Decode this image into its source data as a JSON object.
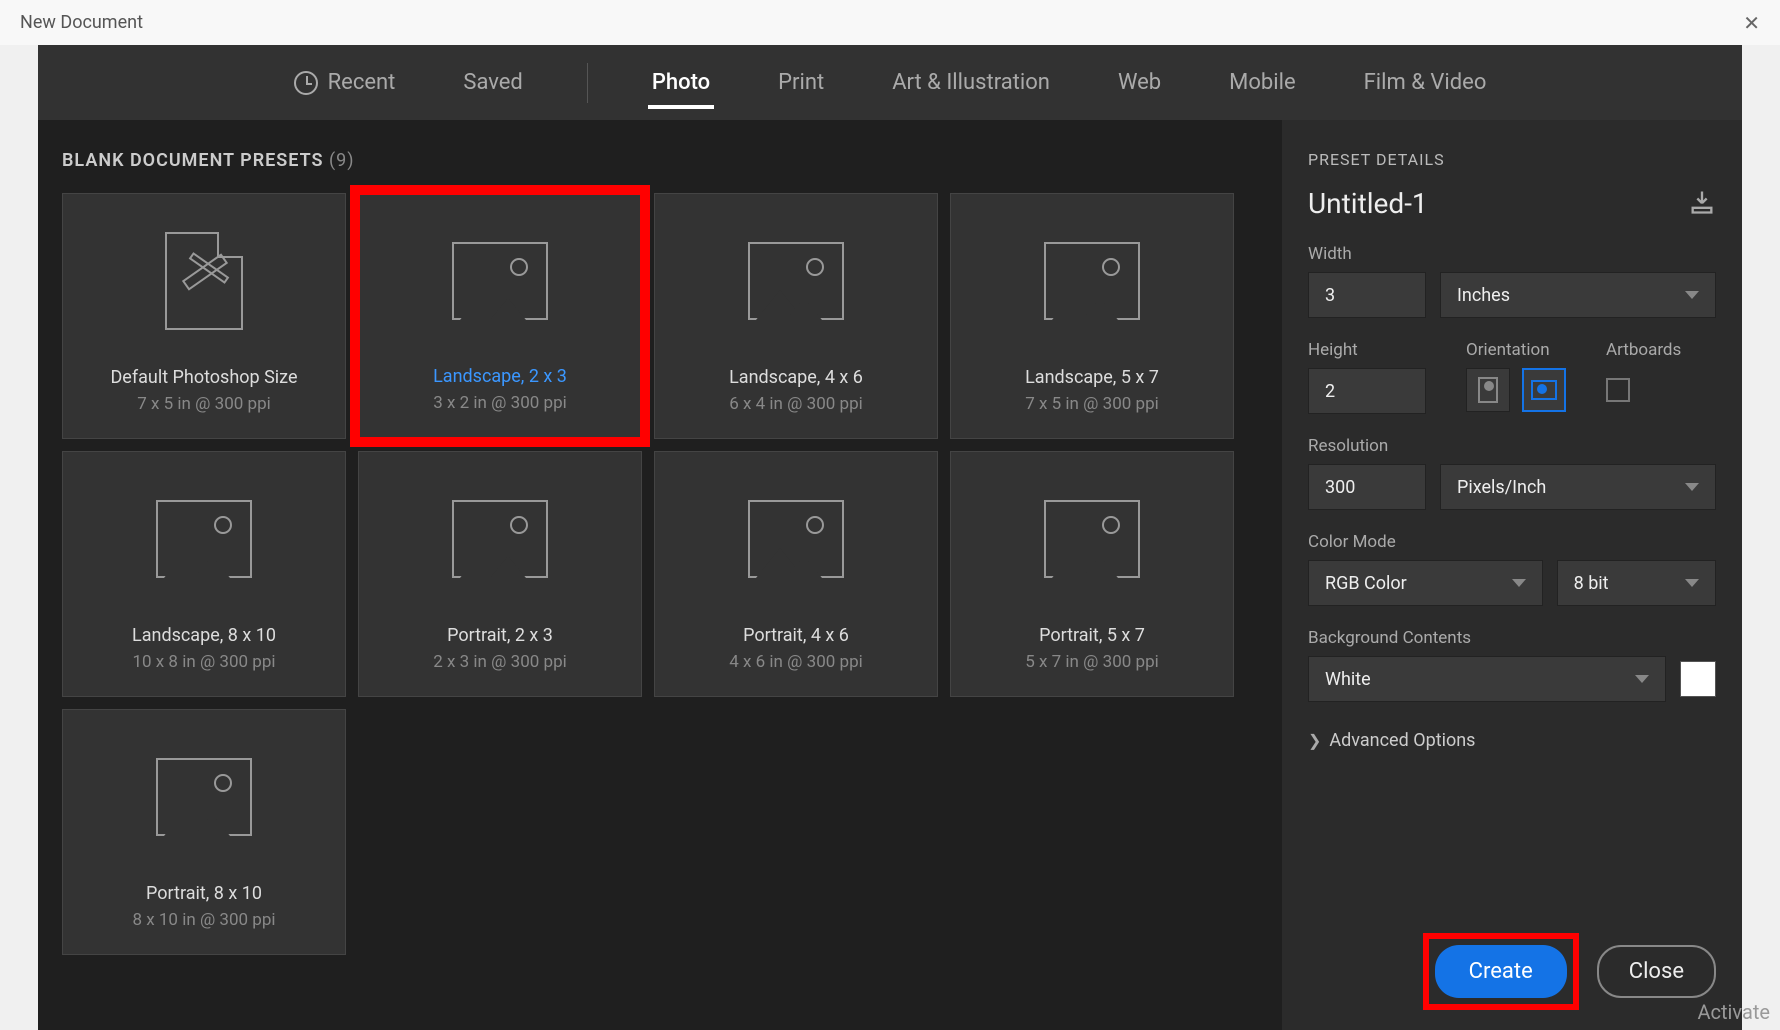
{
  "window": {
    "title": "New Document"
  },
  "tabs": {
    "recent": "Recent",
    "saved": "Saved",
    "photo": "Photo",
    "print": "Print",
    "art": "Art & Illustration",
    "web": "Web",
    "mobile": "Mobile",
    "film": "Film & Video",
    "active": "photo"
  },
  "presets": {
    "header": "BLANK DOCUMENT PRESETS",
    "count": "(9)",
    "items": [
      {
        "title": "Default Photoshop Size",
        "sub": "7 x 5 in @ 300 ppi",
        "icon": "doc",
        "selected": false
      },
      {
        "title": "Landscape, 2 x 3",
        "sub": "3 x 2 in @ 300 ppi",
        "icon": "img",
        "selected": true
      },
      {
        "title": "Landscape, 4 x 6",
        "sub": "6 x 4 in @ 300 ppi",
        "icon": "img",
        "selected": false
      },
      {
        "title": "Landscape, 5 x 7",
        "sub": "7 x 5 in @ 300 ppi",
        "icon": "img",
        "selected": false
      },
      {
        "title": "Landscape, 8 x 10",
        "sub": "10 x 8 in @ 300 ppi",
        "icon": "img",
        "selected": false
      },
      {
        "title": "Portrait, 2 x 3",
        "sub": "2 x 3 in @ 300 ppi",
        "icon": "img",
        "selected": false
      },
      {
        "title": "Portrait, 4 x 6",
        "sub": "4 x 6 in @ 300 ppi",
        "icon": "img",
        "selected": false
      },
      {
        "title": "Portrait, 5 x 7",
        "sub": "5 x 7 in @ 300 ppi",
        "icon": "img",
        "selected": false
      },
      {
        "title": "Portrait, 8 x 10",
        "sub": "8 x 10 in @ 300 ppi",
        "icon": "img",
        "selected": false
      }
    ]
  },
  "details": {
    "header": "PRESET DETAILS",
    "name": "Untitled-1",
    "width_label": "Width",
    "width_value": "3",
    "width_unit": "Inches",
    "height_label": "Height",
    "height_value": "2",
    "orientation_label": "Orientation",
    "artboards_label": "Artboards",
    "resolution_label": "Resolution",
    "resolution_value": "300",
    "resolution_unit": "Pixels/Inch",
    "color_mode_label": "Color Mode",
    "color_mode_value": "RGB Color",
    "bit_depth": "8 bit",
    "bg_label": "Background Contents",
    "bg_value": "White",
    "advanced": "Advanced Options"
  },
  "buttons": {
    "create": "Create",
    "close": "Close"
  },
  "watermark": "Activate"
}
